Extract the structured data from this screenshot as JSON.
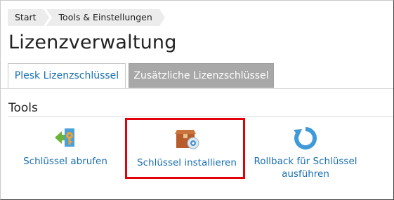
{
  "breadcrumb": {
    "items": [
      "Start",
      "Tools & Einstellungen"
    ]
  },
  "page": {
    "title": "Lizenzverwaltung"
  },
  "tabs": [
    {
      "label": "Plesk Lizenzschlüssel",
      "active": true
    },
    {
      "label": "Zusätzliche Lizenzschlüssel",
      "active": false
    }
  ],
  "tools_section": {
    "title": "Tools",
    "items": [
      {
        "label": "Schlüssel abrufen",
        "icon": "key-retrieve-icon"
      },
      {
        "label": "Schlüssel installieren",
        "icon": "box-install-icon"
      },
      {
        "label_line1": "Rollback für Schlüssel",
        "label_line2": "ausführen",
        "icon": "rollback-icon"
      }
    ]
  },
  "colors": {
    "link": "#1a6fb0",
    "highlight": "#e2000f",
    "inactive_tab": "#a8a8a8"
  }
}
